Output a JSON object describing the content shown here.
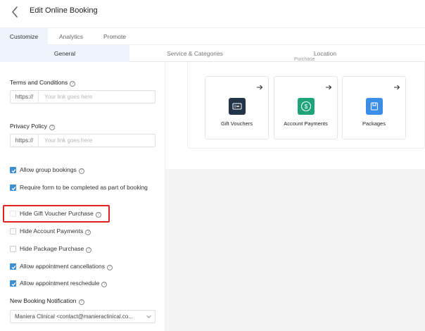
{
  "header": {
    "title": "Edit Online Booking"
  },
  "tabs": [
    {
      "label": "Customize"
    },
    {
      "label": "Analytics"
    },
    {
      "label": "Promote"
    }
  ],
  "subtabs": [
    {
      "label": "General"
    },
    {
      "label": "Service & Categories"
    },
    {
      "label": "Location"
    }
  ],
  "form": {
    "terms": {
      "label": "Terms and Conditions",
      "prefix": "https://",
      "placeholder": "Your link goes here"
    },
    "privacy": {
      "label": "Privacy Policy",
      "prefix": "https://",
      "placeholder": "Your link goes here"
    },
    "checkboxes": [
      {
        "label": "Allow group bookings",
        "checked": true
      },
      {
        "label": "Require form to be completed as part of booking",
        "checked": true
      },
      {
        "label": "Hide Gift Voucher Purchase",
        "checked": false
      },
      {
        "label": "Hide Account Payments",
        "checked": false
      },
      {
        "label": "Hide Package Purchase",
        "checked": false
      },
      {
        "label": "Allow appointment cancellations",
        "checked": true
      },
      {
        "label": "Allow appointment reschedule",
        "checked": true
      }
    ],
    "notification": {
      "label": "New Booking Notification",
      "value": "Maniera Clinical <contact@manieraclinical.co..."
    }
  },
  "preview": {
    "heading": "Purchase",
    "options": [
      {
        "label": "Gift Vouchers",
        "icon": "gift-voucher-icon",
        "color": "#243447"
      },
      {
        "label": "Account Payments",
        "icon": "dollar-icon",
        "color": "#1fa37a"
      },
      {
        "label": "Packages",
        "icon": "package-icon",
        "color": "#3a8ee8"
      }
    ]
  },
  "colors": {
    "accent": "#3e8fd1",
    "highlight": "#e02020",
    "active_tab_bg": "#eef4fb"
  }
}
